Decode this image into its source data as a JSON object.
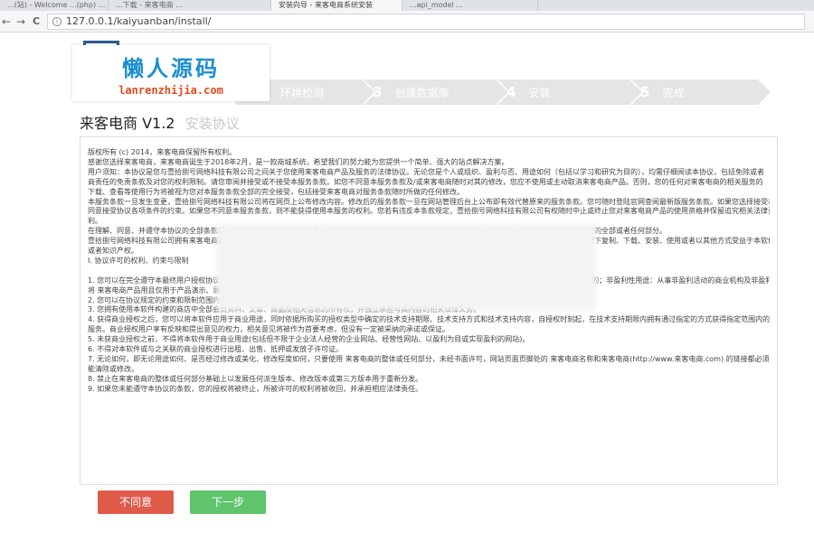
{
  "browser": {
    "tabs": [
      {
        "title": "...(站) - Welcome ...(php) ..."
      },
      {
        "title": "...下载 - 来客电商 ..."
      },
      {
        "title": "安装向导 - 来客电商系统安装",
        "active": true
      },
      {
        "title": "...api_model ..."
      }
    ],
    "url": "127.0.0.1/kaiyuanban/install/",
    "back_icon": "←",
    "forward_icon": "→",
    "reload_icon": "C",
    "info_icon": "i"
  },
  "watermark": {
    "title": "懒人源码",
    "subtitle": "lanrenzhijia.com",
    "title_color": "#1a8fd0",
    "subtitle_color": "#e24a21"
  },
  "steps": [
    {
      "num": "",
      "label": "环境检测"
    },
    {
      "num": "3",
      "label": "创建数据库"
    },
    {
      "num": "4",
      "label": "安装"
    },
    {
      "num": "5",
      "label": "完成"
    }
  ],
  "title": {
    "main": "来客电商 V1.2",
    "sub": "安装协议"
  },
  "license_lines": [
    "版权所有 (c) 2014，来客电商保留所有权利。",
    "感谢您选择来客电商，来客电商诞生于2018年2月，是一款商城系统，希望我们的努力能为您提供一个简单、强大的站点解决方案。",
    "用户须知：本协议是您与壹拾捌号网络科技有限公司之间关于您使用来客电商产品及服务的法律协议。无论您是个人或组织、盈利与否、用途如何（包括以学习和研究为目的），均需仔细阅读本协议，包括免除或者",
    "商责任的免责条款及对您的权利限制。请您审阅并接受或不接受本服务条款。如您不同意本服务条款及/或来客电商随时对其的修改，您应不使用或主动取消来客电商产品。否则，您的任何对来客电商的相关服务的",
    "下载、查看等使用行为将被视为您对本服务条款全部的完全接受，包括接受来客电商对服务条款随时所做的任何修改。",
    "本服务条款一旦发生变更，壹拾捌号网络科技有限公司将在网页上公布修改内容。修改后的服务条款一旦在网站管理后台上公布即有效代替原来的服务条款。您可随时登陆官网查阅最新版服务条款。如果您选择接受本条款",
    "同意接受协议各项条件的约束。如果您不同意本服务条款，则不能获得使用本服务的权利。您若有违反本条款规定，壹拾捌号网络科技有限公司有权随时中止或终止您对来客电商产品的使用资格并保留追究相关法律责任的权",
    "利。",
    "在理解、同意、并遵守本协议的全部条款后，方可开始使用来客电商产品。您可能与壹拾捌号网络科技有限公司直接签订另一书面协议，以补充或者取代本协议的全部或者任何部分。",
    "壹拾捌号网络科技有限公司拥有来客电商的全部知识产权。本软件只供许可协议，并非出售。壹拾捌号网络科技有限公司只允许您在遵守本协议各项条款的情况下复制、下载、安装、使用或者以其他方式受益于本软件",
    "或者知识产权。",
    "I. 协议许可的权利、约束与限制",
    "",
    "1. 您可以在完全遵守本最终用户授权协议的基础上，将本软件应用于非商业用途(包括个人用户：不具备法人资格的自然人，以个人名义从事电子商务开设网店的；非盈利性用途：从事非盈利活动的商业机构及非盈利",
    "   将 来客电商产品用且仅用于产品演示、展示及发布，而并不是用来买卖及盈利的运营活动的)。",
    "2. 您可以在协议规定的约束和限制范围内修改 来客电商源代码(如果被提供的话)或界面风格以适应您的网站要求。",
    "3. 您拥有使用本软件构建的商店中全部会员资料、文章、商品及相关信息的所有权，并独立承担与其内容的相关法律义务。",
    "4. 获得商业授权之后，您可以将本软件应用于商业用途，同时依据所购买的授权类型中确定的技术支持期限、技术支持方式和技术支持内容，自授权时刻起，在技术支持期限内拥有通过指定的方式获得指定范围内的技术支持",
    "   服务。商业授权用户享有反映和提出意见的权力，相关意见将被作为首要考虑，但没有一定被采纳的承诺或保证。",
    "5. 未获商业授权之前，不得将本软件用于商业用途(包括但不限于企业法人经营的企业网站、经营性网站、以盈利为目或实现盈利的网站)。",
    "6. 不得对本软件或与之关联的商业授权进行出租、出售、抵押或发放子许可证。",
    "7. 无论如何，即无论用途如何、是否经过修改或美化、修改程度如何，只要使用 来客电商的整体或任何部分，未经书面许可，网站页面页脚处的 来客电商名称和来客电商(http://www.来客电商.com) 的链接都必须保留，而不",
    "   能清除或修改。",
    "8. 禁止在来客电商的整体或任何部分基础上以发展任何派生版本、修改版本或第三方版本用于重新分发。",
    "9. 如果您未能遵守本协议的条款，您的授权将被终止，所被许可的权利将被收回，并承担相应法律责任。"
  ],
  "buttons": {
    "cancel": "不同意",
    "next": "下一步",
    "cancel_color": "#e05a4a",
    "next_color": "#5fc46b"
  }
}
